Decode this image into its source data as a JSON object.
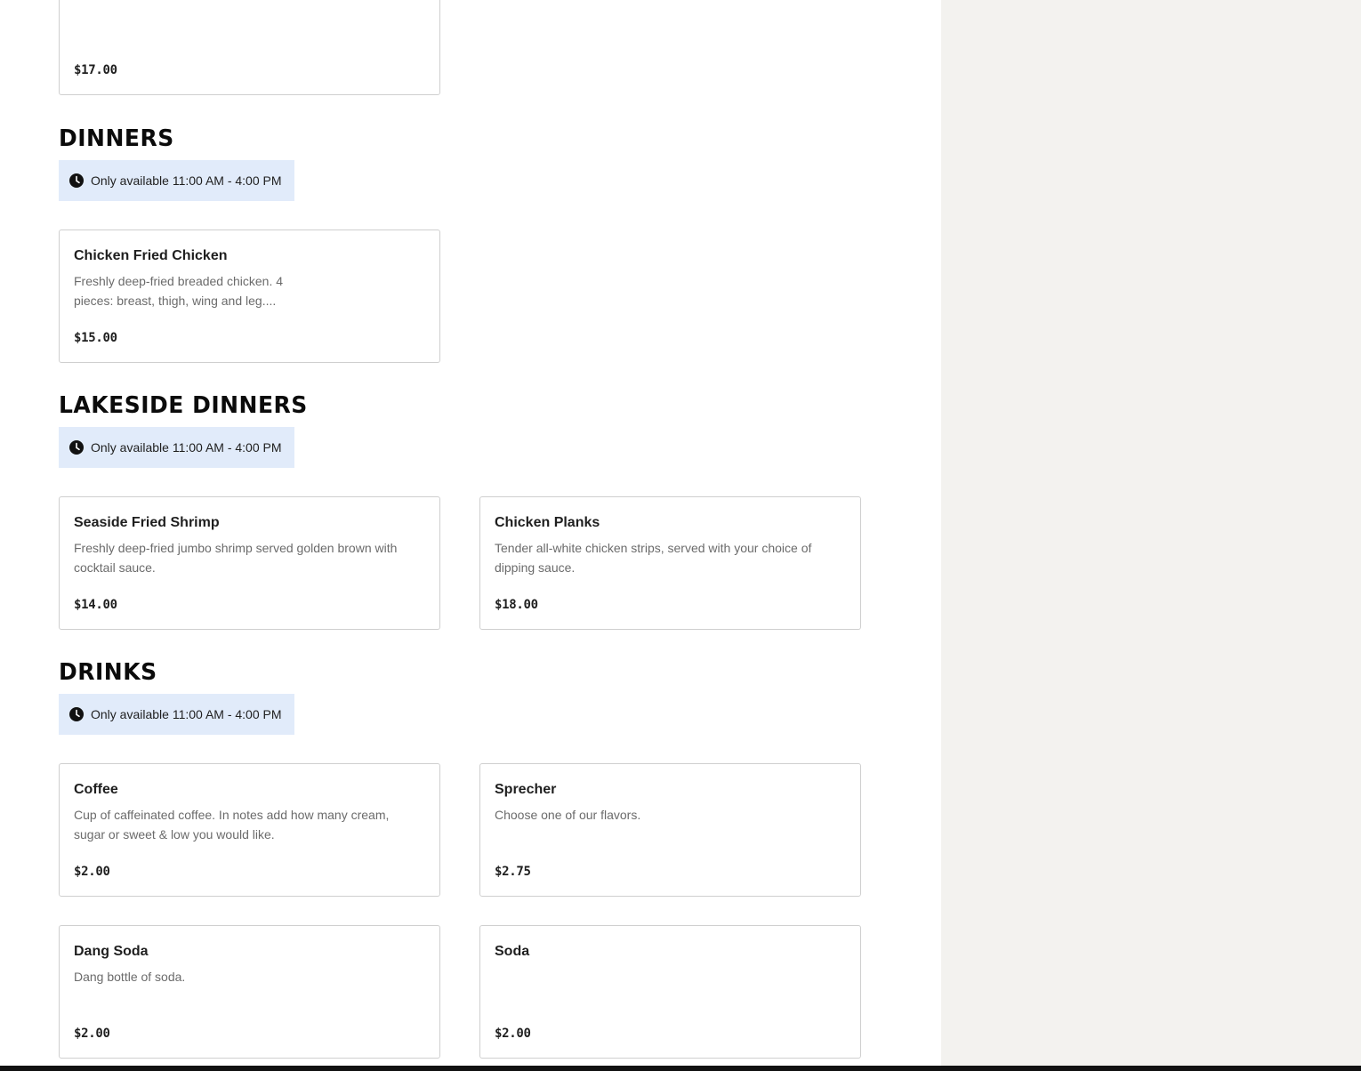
{
  "prev_item": {
    "price": "$17.00"
  },
  "sections": [
    {
      "title": "DINNERS",
      "availability": "Only available 11:00 AM - 4:00 PM",
      "items": [
        {
          "name": "Chicken Fried Chicken",
          "description": "Freshly deep-fried breaded chicken. 4 pieces: breast, thigh, wing and leg....",
          "price": "$15.00"
        }
      ]
    },
    {
      "title": "LAKESIDE DINNERS",
      "availability": "Only available 11:00 AM - 4:00 PM",
      "items": [
        {
          "name": "Seaside Fried Shrimp",
          "description": "Freshly deep-fried jumbo shrimp served golden brown with cocktail sauce.",
          "price": "$14.00"
        },
        {
          "name": "Chicken Planks",
          "description": "Tender all-white chicken strips, served with your choice of dipping sauce.",
          "price": "$18.00"
        }
      ]
    },
    {
      "title": "DRINKS",
      "availability": "Only available 11:00 AM - 4:00 PM",
      "items": [
        {
          "name": "Coffee",
          "description": "Cup of caffeinated coffee. In notes add how many cream, sugar or sweet & low you would like.",
          "price": "$2.00"
        },
        {
          "name": "Sprecher",
          "description": "Choose one of our flavors.",
          "price": "$2.75"
        },
        {
          "name": "Dang Soda",
          "description": "Dang bottle of soda.",
          "price": "$2.00"
        },
        {
          "name": "Soda",
          "description": "",
          "price": "$2.00"
        }
      ]
    }
  ],
  "icons": {
    "availability": "clock-icon"
  }
}
